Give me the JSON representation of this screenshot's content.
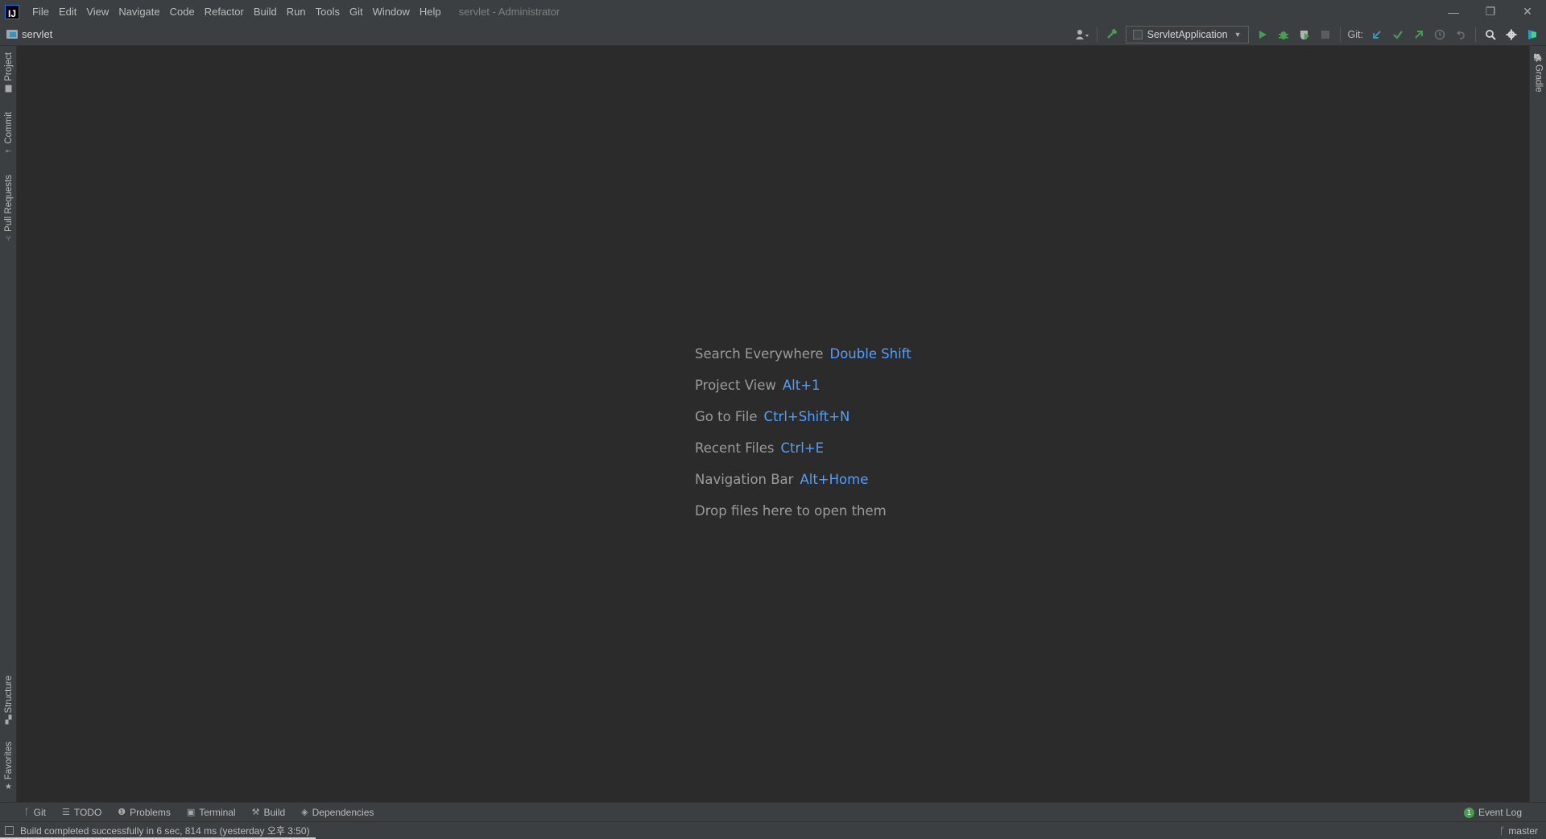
{
  "window": {
    "title": "servlet - Administrator",
    "logo_text": "IJ",
    "menu": [
      "File",
      "Edit",
      "View",
      "Navigate",
      "Code",
      "Refactor",
      "Build",
      "Run",
      "Tools",
      "Git",
      "Window",
      "Help"
    ],
    "controls": {
      "minimize": "—",
      "restore": "❐",
      "close": "✕"
    }
  },
  "toolbar": {
    "project_name": "servlet",
    "run_config": "ServletApplication",
    "git_label": "Git:",
    "icons": [
      "user-icon",
      "build-hammer-icon",
      "run-icon",
      "debug-icon",
      "coverage-icon",
      "stop-icon",
      "git-update-icon",
      "git-commit-icon",
      "git-push-icon",
      "history-icon",
      "rollback-icon",
      "search-icon",
      "settings-icon",
      "toolbox-icon"
    ],
    "colors": {
      "run": "#499c54",
      "git_update": "#3592c4",
      "git_commit": "#499c54"
    }
  },
  "left_tabs": {
    "project": "Project",
    "commit": "Commit",
    "pull_requests": "Pull Requests",
    "structure": "Structure",
    "favorites": "Favorites"
  },
  "right_tabs": {
    "gradle": "Gradle"
  },
  "editor": {
    "hints": [
      {
        "label": "Search Everywhere",
        "key": "Double Shift"
      },
      {
        "label": "Project View",
        "key": "Alt+1"
      },
      {
        "label": "Go to File",
        "key": "Ctrl+Shift+N"
      },
      {
        "label": "Recent Files",
        "key": "Ctrl+E"
      },
      {
        "label": "Navigation Bar",
        "key": "Alt+Home"
      },
      {
        "label": "Drop files here to open them",
        "key": ""
      }
    ],
    "key_color": "#589df6"
  },
  "bottom_tabs": [
    "Git",
    "TODO",
    "Problems",
    "Terminal",
    "Build",
    "Dependencies"
  ],
  "event_log": {
    "label": "Event Log",
    "count": "1"
  },
  "status": {
    "message": "Build completed successfully in 6 sec, 814 ms (yesterday 오후 3:50)",
    "branch": "master"
  }
}
